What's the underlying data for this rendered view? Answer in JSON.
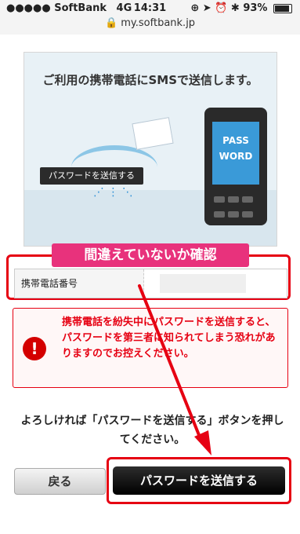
{
  "status_bar": {
    "signal": "●●●●● SoftBank",
    "network": "4G",
    "time": "14:31",
    "battery": "93%"
  },
  "browser": {
    "url": "my.softbank.jp"
  },
  "hero": {
    "caption": "ご利用の携帯電話にSMSで送信します。",
    "button_label": "パスワードを送信する",
    "phone_screen_line1": "PASS",
    "phone_screen_line2": "WORD"
  },
  "annotation": {
    "confirm_label": "間違えていないか確認",
    "highlight_color": "#e60012",
    "banner_color": "#e8327c"
  },
  "phone_row": {
    "label": "携帯電話番号",
    "value": ""
  },
  "warning": {
    "icon": "exclamation-icon",
    "text": "携帯電話を紛失中にパスワードを送信すると、パスワードを第三者に知られてしまう恐れがありますのでお控えください。"
  },
  "instruction": "よろしければ「パスワードを送信する」ボタンを押してください。",
  "buttons": {
    "back_label": "戻る",
    "send_label": "パスワードを送信する"
  }
}
